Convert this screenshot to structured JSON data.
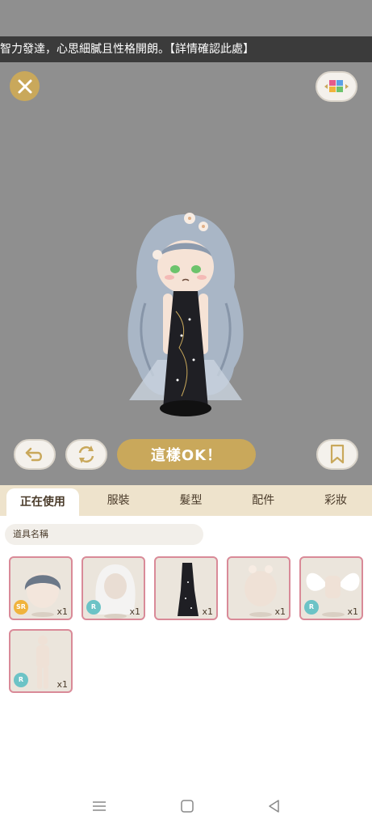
{
  "ticker": {
    "text": "智力發達，心思細膩且性格開朗。【詳情確認此處】"
  },
  "actions": {
    "ok_label": "這樣OK！"
  },
  "tabs": [
    {
      "label": "正在使用",
      "active": true
    },
    {
      "label": "服裝",
      "active": false
    },
    {
      "label": "髮型",
      "active": false
    },
    {
      "label": "配件",
      "active": false
    },
    {
      "label": "彩妝",
      "active": false
    }
  ],
  "search": {
    "placeholder": "道具名稱"
  },
  "items": [
    {
      "rarity": "SR",
      "qty": "x1",
      "icon": "short-hair-icon"
    },
    {
      "rarity": "R",
      "qty": "x1",
      "icon": "long-white-hair-icon"
    },
    {
      "rarity": "",
      "qty": "x1",
      "icon": "black-dress-icon"
    },
    {
      "rarity": "",
      "qty": "x1",
      "icon": "flower-hair-accessory-icon"
    },
    {
      "rarity": "R",
      "qty": "x1",
      "icon": "wings-icon"
    },
    {
      "rarity": "R",
      "qty": "x1",
      "icon": "body-base-icon"
    }
  ],
  "colors": {
    "gold": "#c9a85b",
    "stage": "#8f8f8f",
    "tab_bar": "#eee3cc",
    "item_border": "#d98a98"
  }
}
